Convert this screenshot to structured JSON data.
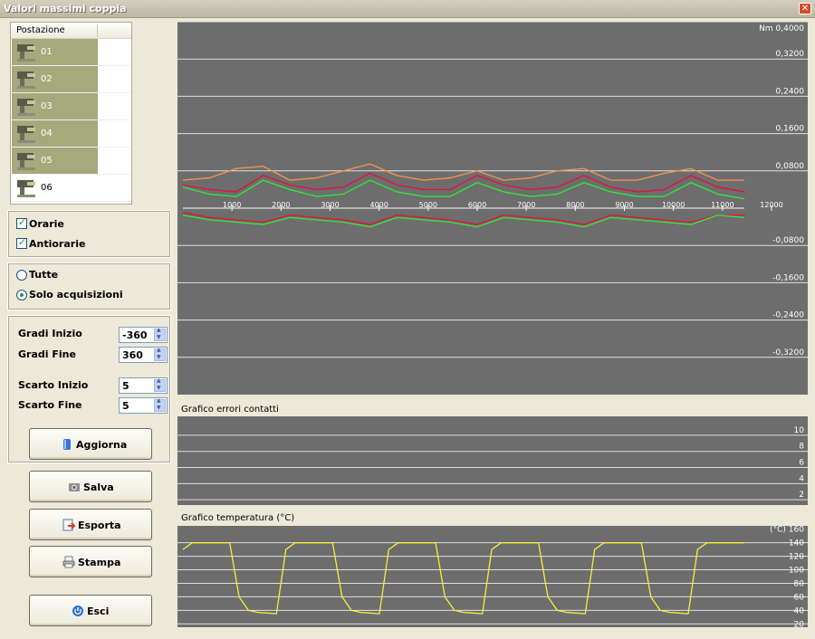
{
  "window": {
    "title": "Valori massimi coppia"
  },
  "stations": {
    "header": "Postazione",
    "items": [
      {
        "label": "01",
        "selected": true
      },
      {
        "label": "02",
        "selected": true
      },
      {
        "label": "03",
        "selected": true
      },
      {
        "label": "04",
        "selected": true
      },
      {
        "label": "05",
        "selected": true
      },
      {
        "label": "06",
        "selected": false
      }
    ]
  },
  "direction": {
    "orarie": "Orarie",
    "antiorarie": "Antiorarie",
    "orarie_checked": true,
    "antiorarie_checked": true
  },
  "filter": {
    "tutte": "Tutte",
    "solo": "Solo acquisizioni",
    "selected": "solo"
  },
  "params": {
    "gradi_inizio_label": "Gradi Inizio",
    "gradi_inizio": "-360",
    "gradi_fine_label": "Gradi Fine",
    "gradi_fine": "360",
    "scarto_inizio_label": "Scarto Inizio",
    "scarto_inizio": "5",
    "scarto_fine_label": "Scarto Fine",
    "scarto_fine": "5"
  },
  "buttons": {
    "aggiorna": "Aggiorna",
    "salva": "Salva",
    "esporta": "Esporta",
    "stampa": "Stampa",
    "esci": "Esci"
  },
  "colors": {
    "plot_bg": "#6d6d6d",
    "red": "#e0143c",
    "green": "#36e23c",
    "orange": "#f0934e",
    "yellow": "#f5ef3a"
  },
  "chart_data": [
    {
      "type": "line",
      "title": "",
      "ylabel": "Nm",
      "y_ticks": [
        "0,4000",
        "0,3200",
        "0,2400",
        "0,1600",
        "0,0800",
        "-0,0800",
        "-0,1600",
        "-0,2400",
        "-0,3200"
      ],
      "x_ticks": [
        "1000",
        "2000",
        "3000",
        "4000",
        "5000",
        "6000",
        "7000",
        "8000",
        "9000",
        "10000",
        "11000",
        "12000"
      ],
      "ylim": [
        -0.4,
        0.4
      ],
      "xlim": [
        0,
        12000
      ],
      "series": [
        {
          "color": "red",
          "values": [
            0.05,
            0.04,
            0.035,
            0.07,
            0.05,
            0.04,
            0.045,
            0.075,
            0.05,
            0.04,
            0.04,
            0.07,
            0.05,
            0.04,
            0.045,
            0.07,
            0.045,
            0.035,
            0.04,
            0.07,
            0.045,
            0.035
          ]
        },
        {
          "color": "orange",
          "values": [
            0.06,
            0.065,
            0.085,
            0.09,
            0.06,
            0.065,
            0.08,
            0.095,
            0.07,
            0.06,
            0.065,
            0.08,
            0.06,
            0.065,
            0.08,
            0.085,
            0.06,
            0.06,
            0.075,
            0.085,
            0.06,
            0.06
          ]
        },
        {
          "color": "green",
          "values": [
            0.045,
            0.03,
            0.025,
            0.06,
            0.04,
            0.025,
            0.03,
            0.06,
            0.035,
            0.025,
            0.025,
            0.055,
            0.035,
            0.025,
            0.03,
            0.055,
            0.035,
            0.025,
            0.025,
            0.055,
            0.03,
            0.02
          ]
        },
        {
          "color": "red",
          "values": [
            -0.01,
            -0.02,
            -0.025,
            -0.03,
            -0.015,
            -0.02,
            -0.025,
            -0.035,
            -0.015,
            -0.02,
            -0.025,
            -0.035,
            -0.015,
            -0.02,
            -0.025,
            -0.035,
            -0.015,
            -0.02,
            -0.025,
            -0.03,
            -0.015,
            -0.015
          ]
        },
        {
          "color": "green",
          "values": [
            -0.015,
            -0.025,
            -0.03,
            -0.035,
            -0.02,
            -0.025,
            -0.03,
            -0.04,
            -0.02,
            -0.025,
            -0.03,
            -0.04,
            -0.02,
            -0.025,
            -0.03,
            -0.04,
            -0.02,
            -0.025,
            -0.03,
            -0.035,
            -0.015,
            -0.02
          ]
        }
      ]
    },
    {
      "type": "line",
      "title": "Grafico errori contatti",
      "y_ticks": [
        "10",
        "8",
        "6",
        "4",
        "2"
      ],
      "ylim": [
        0,
        11
      ],
      "series": []
    },
    {
      "type": "line",
      "title": "Grafico temperatura (°C)",
      "ylabel": "(°C)",
      "y_ticks": [
        "160",
        "140",
        "120",
        "100",
        "80",
        "60",
        "40",
        "20"
      ],
      "ylim": [
        15,
        165
      ],
      "series": [
        {
          "color": "yellow",
          "values": [
            130,
            140,
            140,
            140,
            140,
            140,
            60,
            40,
            37,
            36,
            35,
            130,
            140,
            140,
            140,
            140,
            140,
            60,
            40,
            37,
            36,
            35,
            130,
            140,
            140,
            140,
            140,
            140,
            60,
            40,
            37,
            36,
            35,
            130,
            140,
            140,
            140,
            140,
            140,
            60,
            40,
            37,
            36,
            35,
            130,
            140,
            140,
            140,
            140,
            140,
            60,
            40,
            37,
            36,
            35,
            130,
            140,
            140,
            140,
            140,
            140
          ]
        }
      ]
    }
  ]
}
